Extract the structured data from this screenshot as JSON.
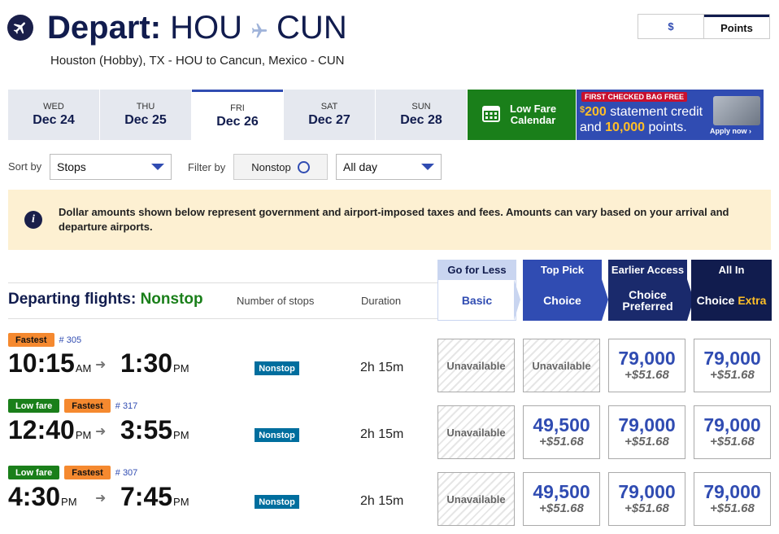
{
  "header": {
    "depart_label": "Depart:",
    "origin": "HOU",
    "destination": "CUN",
    "subtitle": "Houston (Hobby), TX - HOU to Cancun, Mexico - CUN"
  },
  "currency_toggle": {
    "dollar": "$",
    "points": "Points",
    "selected": "Points"
  },
  "dates": [
    {
      "dow": "WED",
      "date": "Dec 24",
      "active": false
    },
    {
      "dow": "THU",
      "date": "Dec 25",
      "active": false
    },
    {
      "dow": "FRI",
      "date": "Dec 26",
      "active": true
    },
    {
      "dow": "SAT",
      "date": "Dec 27",
      "active": false
    },
    {
      "dow": "SUN",
      "date": "Dec 28",
      "active": false
    }
  ],
  "low_fare_calendar": {
    "line1": "Low Fare",
    "line2": "Calendar"
  },
  "promo": {
    "badge": "FIRST CHECKED BAG FREE",
    "dollar_sign": "$",
    "amount": "200",
    "line1_rest": " statement credit",
    "line2_pre": "and ",
    "points": "10,000",
    "line2_post": " points.",
    "apply": "Apply now ›"
  },
  "controls": {
    "sort_label": "Sort by",
    "sort_value": "Stops",
    "filter_label": "Filter by",
    "nonstop_label": "Nonstop",
    "time_value": "All day"
  },
  "banner": {
    "text": "Dollar amounts shown below represent government and airport-imposed taxes and fees. Amounts can vary based on your arrival and departure airports."
  },
  "table": {
    "title_prefix": "Departing flights: ",
    "title_filter": "Nonstop",
    "col_stops": "Number of stops",
    "col_duration": "Duration",
    "fares": [
      {
        "tag": "Go for Less",
        "name": "Basic",
        "name2": "",
        "tag_color": "#c9d5f0",
        "body_color": "#ffffff"
      },
      {
        "tag": "Top Pick",
        "name": "Choice",
        "name2": "",
        "tag_color": "#304cb2",
        "body_color": "#304cb2"
      },
      {
        "tag": "Earlier Access",
        "name": "Choice",
        "name2": "Preferred",
        "tag_color": "#1a2a6c",
        "body_color": "#1a2a6c"
      },
      {
        "tag": "All In",
        "name": "Choice ",
        "name2": "Extra",
        "tag_color": "#111c4e",
        "body_color": "#111c4e"
      }
    ]
  },
  "flights": [
    {
      "tags": [
        "Fastest"
      ],
      "flight_no": "# 305",
      "depart_time": "10:15",
      "depart_ap": "AM",
      "arrive_time": "1:30",
      "arrive_ap": "PM",
      "stops": "Nonstop",
      "duration": "2h 15m",
      "fares": [
        {
          "unavailable": "Unavailable"
        },
        {
          "unavailable": "Unavailable"
        },
        {
          "points": "79,000",
          "tax": "+$51.68"
        },
        {
          "points": "79,000",
          "tax": "+$51.68"
        }
      ]
    },
    {
      "tags": [
        "Low fare",
        "Fastest"
      ],
      "flight_no": "# 317",
      "depart_time": "12:40",
      "depart_ap": "PM",
      "arrive_time": "3:55",
      "arrive_ap": "PM",
      "stops": "Nonstop",
      "duration": "2h 15m",
      "fares": [
        {
          "unavailable": "Unavailable"
        },
        {
          "points": "49,500",
          "tax": "+$51.68"
        },
        {
          "points": "79,000",
          "tax": "+$51.68"
        },
        {
          "points": "79,000",
          "tax": "+$51.68"
        }
      ]
    },
    {
      "tags": [
        "Low fare",
        "Fastest"
      ],
      "flight_no": "# 307",
      "depart_time": "4:30",
      "depart_ap": "PM",
      "arrive_time": "7:45",
      "arrive_ap": "PM",
      "stops": "Nonstop",
      "duration": "2h 15m",
      "fares": [
        {
          "unavailable": "Unavailable"
        },
        {
          "points": "49,500",
          "tax": "+$51.68"
        },
        {
          "points": "79,000",
          "tax": "+$51.68"
        },
        {
          "points": "79,000",
          "tax": "+$51.68"
        }
      ]
    }
  ]
}
